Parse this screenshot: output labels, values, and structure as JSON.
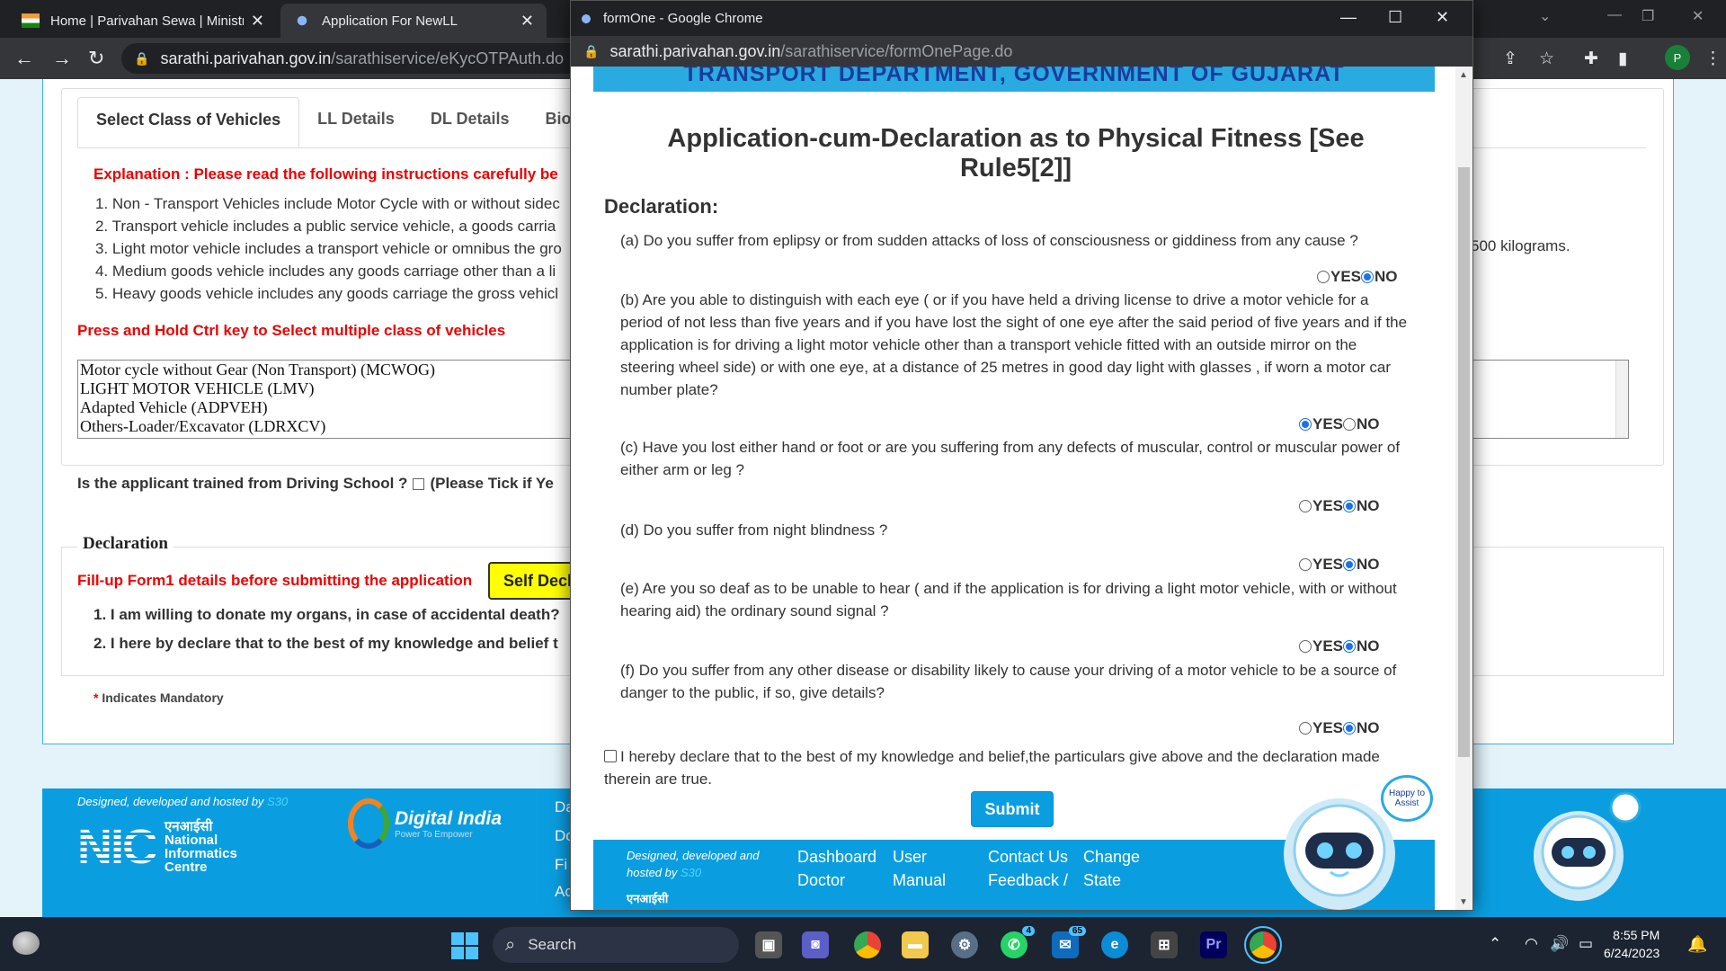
{
  "browser": {
    "tabs": [
      {
        "title": "Home | Parivahan Sewa | Ministry",
        "close": "✕"
      },
      {
        "title": "Application For NewLL",
        "close": "✕"
      }
    ],
    "address_host": "sarathi.parivahan.gov.in",
    "address_path": "/sarathiservice/eKycOTPAuth.do",
    "profile_initial": "P"
  },
  "background_page": {
    "tabs": [
      "Select Class of Vehicles",
      "LL Details",
      "DL Details",
      "Bior"
    ],
    "explanation": "Explanation : Please read the following instructions carefully be",
    "rules": [
      "1. Non - Transport Vehicles include Motor Cycle with or without sidec",
      "2. Transport vehicle includes a public service vehicle, a goods carria",
      "3. Light motor vehicle includes a transport vehicle or omnibus the gro",
      "4. Medium goods vehicle includes any goods carriage other than a li",
      "5. Heavy goods vehicle includes any goods carriage the gross vehicl"
    ],
    "kilograms_tail": "500 kilograms.",
    "press_hold": "Press and Hold Ctrl key to Select multiple class of vehicles",
    "vehicle_classes": [
      "Motor cycle without Gear (Non Transport) (MCWOG)",
      "LIGHT MOTOR VEHICLE (LMV)",
      "Adapted Vehicle (ADPVEH)",
      "Others-Loader/Excavator (LDRXCV)"
    ],
    "trained_question": "Is the applicant trained from Driving School ?",
    "trained_hint": "(Please Tick if Ye",
    "declaration_legend": "Declaration",
    "fillup_notice": "Fill-up Form1 details before submitting the application",
    "self_decl_button": "Self Decl",
    "declaration_items": [
      "1. I am willing to donate my organs, in case of accidental death?",
      "2. I here by declare that to the best of my knowledge and belief t"
    ],
    "mandatory_star": "*",
    "mandatory_note": "Indicates Mandatory",
    "footer": {
      "designed_by": "Designed, developed and hosted by",
      "designed_by_s30": "S30",
      "nic_hindi": "एनआईसी",
      "nic_name_1": "National",
      "nic_name_2": "Informatics",
      "nic_name_3": "Centre",
      "digital_india": "Digital India",
      "digital_india_tagline": "Power To Empower",
      "partial_links": [
        "Da",
        "Do",
        "Fi",
        "Ac"
      ]
    }
  },
  "popup": {
    "window_title": "formOne - Google Chrome",
    "address_host": "sarathi.parivahan.gov.in",
    "address_path": "/sarathiservice/formOnePage.do",
    "department_header": "TRANSPORT DEPARTMENT, GOVERNMENT OF GUJARAT",
    "heading": "Application-cum-Declaration as to Physical Fitness [See Rule5[2]]",
    "declaration_label": "Declaration:",
    "yes_label": "YES",
    "no_label": "NO",
    "questions": [
      {
        "text": "(a) Do you suffer from eplipsy or from sudden attacks of loss of consciousness or giddiness from any cause ?",
        "answer": "NO"
      },
      {
        "text": "(b) Are you able to distinguish with each eye ( or if you have held a driving license to drive a motor vehicle for a period of not less than five years and if you have lost the sight of one eye after the said period of five years and if the application is for driving a light motor vehicle other than a transport vehicle fitted with an outside mirror on the steering wheel side) or with one eye, at a distance of 25 metres in good day light with glasses , if worn a motor car number plate?",
        "answer": "YES"
      },
      {
        "text": "(c) Have you lost either hand or foot or are you suffering from any defects of muscular, control or muscular power of either arm or leg ?",
        "answer": "NO"
      },
      {
        "text": "(d) Do you suffer from night blindness ?",
        "answer": "NO"
      },
      {
        "text": "(e) Are you so deaf as to be unable to hear ( and if the application is for driving a light motor vehicle, with or without hearing aid) the ordinary sound signal ?",
        "answer": "NO"
      },
      {
        "text": "(f) Do you suffer from any other disease or disability likely to cause your driving of a motor vehicle to be a source of danger to the public, if so, give details?",
        "answer": "NO"
      }
    ],
    "final_declaration": "I hereby declare that to the best of my knowledge and belief,the particulars give above and the declaration made therein are true.",
    "submit_label": "Submit",
    "footer": {
      "designed_by": "Designed, developed and",
      "hosted_by": "hosted by",
      "designed_by_s30": "S30",
      "nic_hindi": "एनआईसी",
      "links_row1": [
        "Dashboard",
        "User",
        "Contact Us",
        "Change"
      ],
      "links_row2": [
        "Doctor",
        "Manual",
        "Feedback /",
        "State"
      ]
    },
    "assistant_bubble": "Happy to Assist"
  },
  "taskbar": {
    "search_label": "Search",
    "whatsapp_badge": "4",
    "mail_badge": "65",
    "premiere_label": "Pr",
    "time": "8:55 PM",
    "date": "6/24/2023"
  },
  "colors": {
    "accent": "#0a9ee0",
    "header_blue": "#29abe2",
    "alert_red": "#ee0000",
    "chrome_dark": "#202124",
    "selected_radio": "#1a73e8"
  }
}
